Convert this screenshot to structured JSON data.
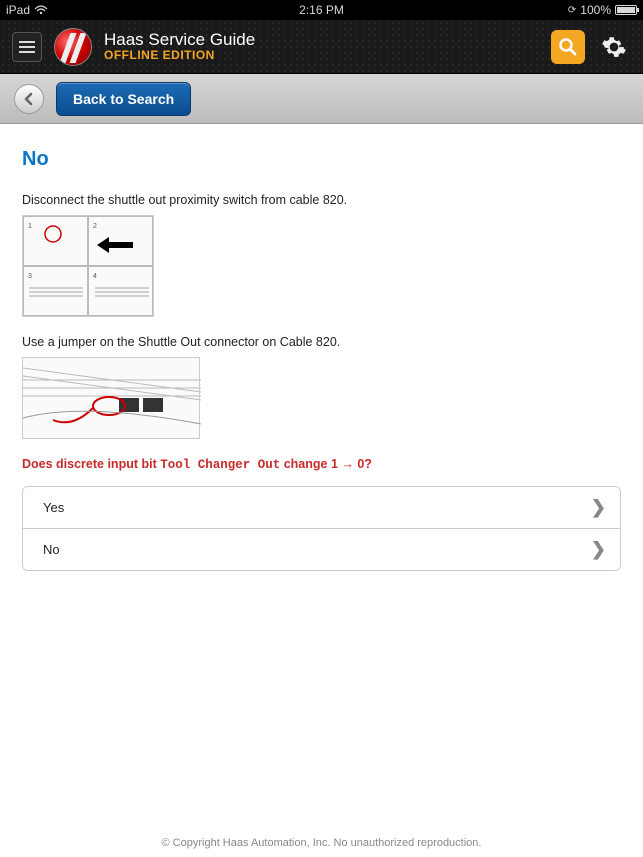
{
  "status": {
    "device": "iPad",
    "time": "2:16 PM",
    "battery": "100%"
  },
  "header": {
    "title": "Haas Service Guide",
    "subtitle": "OFFLINE EDITION"
  },
  "toolbar": {
    "back_to_search": "Back to Search"
  },
  "page": {
    "heading": "No",
    "para1": "Disconnect the shuttle out proximity switch from cable 820.",
    "para2": "Use a jumper on the Shuttle Out connector on Cable 820.",
    "question_prefix": "Does discrete input bit ",
    "question_mono": "Tool Changer Out",
    "question_suffix": " change 1 → 0?"
  },
  "options": [
    {
      "label": "Yes"
    },
    {
      "label": "No"
    }
  ],
  "footer": "© Copyright Haas Automation, Inc. No unauthorized reproduction."
}
